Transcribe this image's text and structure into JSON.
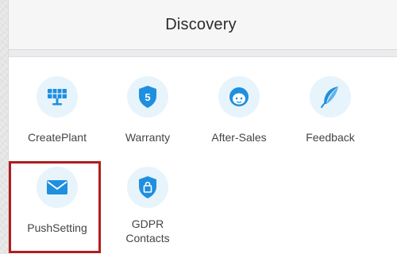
{
  "header": {
    "title": "Discovery"
  },
  "colors": {
    "icon_blue": "#1f8fe0",
    "icon_bg": "#e7f4fb",
    "highlight_border": "#b31d1d"
  },
  "items": [
    {
      "label": "CreatePlant",
      "icon": "solar-panel-icon"
    },
    {
      "label": "Warranty",
      "icon": "shield-5-icon"
    },
    {
      "label": "After-Sales",
      "icon": "support-agent-icon"
    },
    {
      "label": "Feedback",
      "icon": "feather-quill-icon"
    },
    {
      "label": "PushSetting",
      "icon": "envelope-icon"
    },
    {
      "label": "GDPR\nContacts",
      "icon": "lock-shield-icon"
    }
  ]
}
